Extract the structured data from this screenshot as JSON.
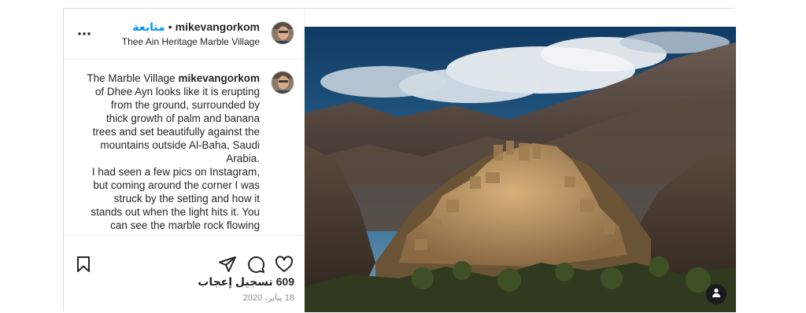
{
  "header": {
    "username": "mikevangorkom",
    "follow_label": "متابعة",
    "separator": "•",
    "location": "Thee Ain Heritage Marble Village"
  },
  "caption": {
    "prefix": "The Marble Village",
    "username": "mikevangorkom",
    "paragraph1": "of Dhee Ayn looks like it is erupting from the ground, surrounded by thick growth of palm and banana trees and set beautifully against the mountains outside Al-Baha, Saudi Arabia.",
    "paragraph2": "I had seen a few pics on Instagram, but coming around the corner I was struck by the setting and how it stands out when the light hits it. You can see the marble rock flowing through the village, and the"
  },
  "stats": {
    "likes": "609 تسجيل إعجاب",
    "date": "18 يناير، 2020"
  },
  "icons": {
    "more": "more-options-icon",
    "save": "bookmark-icon",
    "share": "share-icon",
    "comment": "comment-icon",
    "like": "heart-icon",
    "tagged_user": "user-tag-icon"
  }
}
